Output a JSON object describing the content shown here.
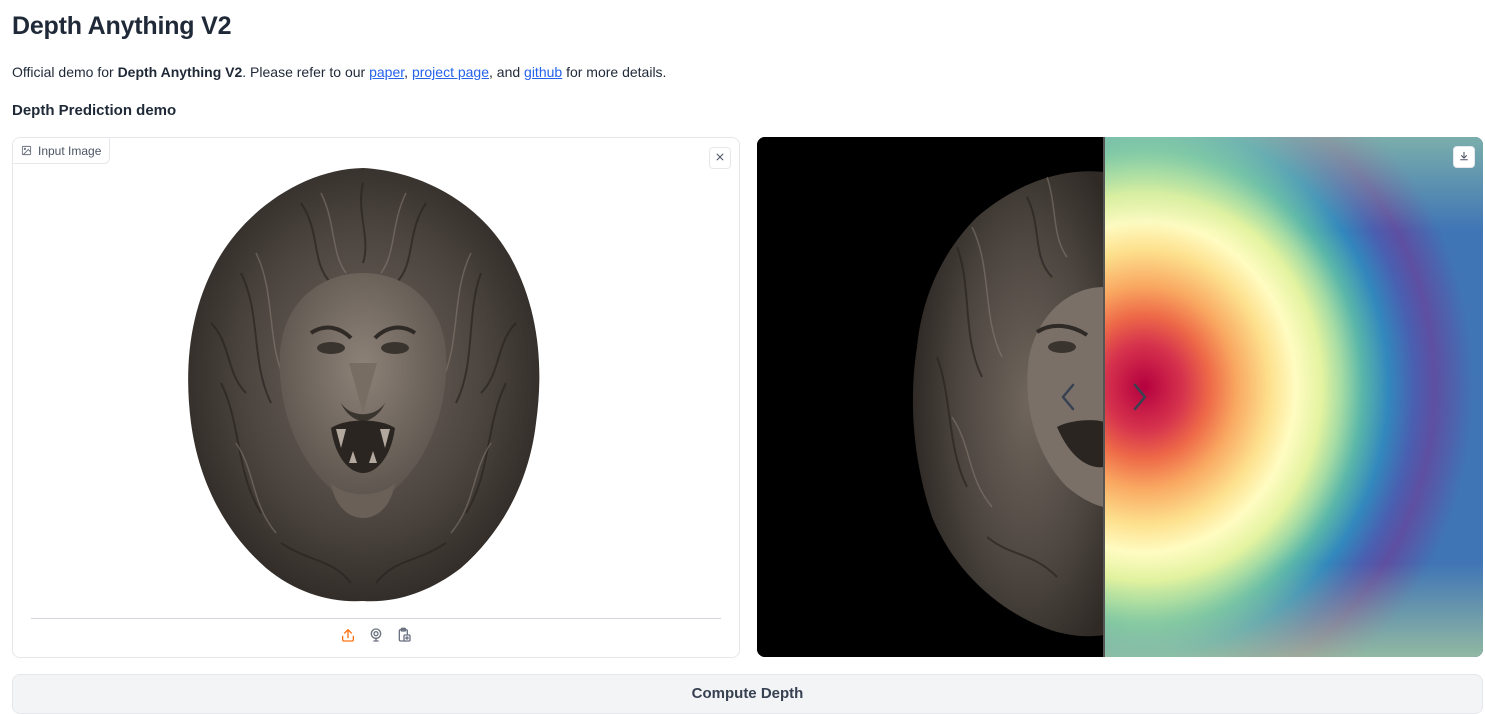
{
  "page": {
    "title": "Depth Anything V2",
    "description": {
      "prefix": "Official demo for ",
      "bold": "Depth Anything V2",
      "middle": ". Please refer to our ",
      "link_paper": "paper",
      "sep1": ", ",
      "link_project": "project page",
      "sep2": ", and ",
      "link_github": "github",
      "suffix": " for more details."
    },
    "section_title": "Depth Prediction demo"
  },
  "input_panel": {
    "label": "Input Image",
    "label_icon": "image-icon",
    "clear_icon": "close-icon",
    "sources": [
      {
        "icon": "upload-icon",
        "color": "#f97316"
      },
      {
        "icon": "webcam-icon",
        "color": "#6b7280"
      },
      {
        "icon": "clipboard-icon",
        "color": "#6b7280"
      }
    ]
  },
  "output_panel": {
    "download_icon": "download-icon",
    "left_arrow_icon": "chevron-left-icon",
    "right_arrow_icon": "chevron-right-icon",
    "slider_position": 0.478
  },
  "actions": {
    "compute_label": "Compute Depth"
  }
}
